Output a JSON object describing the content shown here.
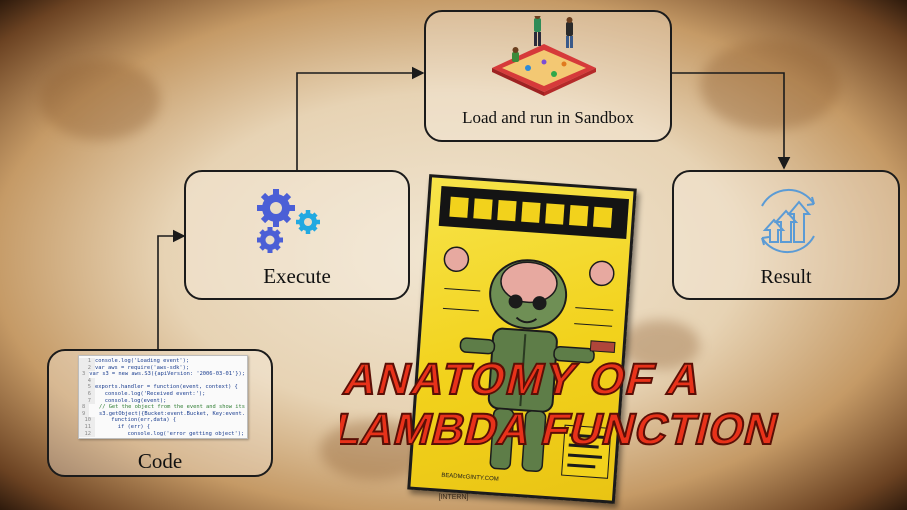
{
  "nodes": {
    "sandbox": {
      "label": "Load and run in Sandbox",
      "icon": "sandbox-icon"
    },
    "execute": {
      "label": "Execute",
      "icon": "gears-icon"
    },
    "result": {
      "label": "Result",
      "icon": "growth-arrows-icon"
    },
    "code": {
      "label": "Code",
      "icon": "code-snippet-icon"
    }
  },
  "code_snippet": [
    "console.log('Loading event');",
    "var aws = require('aws-sdk');",
    "var s3 = new aws.S3({apiVersion: '2006-03-01'});",
    "",
    "exports.handler = function(event, context) {",
    "   console.log('Received event:');",
    "   console.log(event);",
    "   // Get the object from the event and show its",
    "   s3.getObject({Bucket:event.Bucket, Key:event.",
    "     function(err,data) {",
    "       if (err) {",
    "          console.log('error getting object');"
  ],
  "title_art": [
    "ANATOMY OF A",
    "LAMBDA FUNCTION"
  ],
  "poster_credit": "BEADMcGINTY.COM",
  "footer": "[INTERN]",
  "colors": {
    "box_border": "#1b1b1b",
    "gear_blue": "#4b5fd6",
    "gear_cyan": "#21a9e1",
    "result_blue": "#5b9bd5",
    "sandbox_red": "#d63a3a",
    "title_fill": "#e8321a",
    "title_outline": "#5a0f06",
    "poster_yellow": "#f2d21c"
  }
}
